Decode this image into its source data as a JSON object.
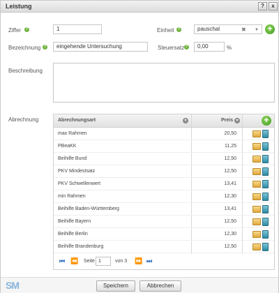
{
  "window": {
    "title": "Leistung",
    "help_label": "?",
    "close_label": "x"
  },
  "form": {
    "ziffer_label": "Ziffer",
    "ziffer_value": "1",
    "einheit_label": "Einheit",
    "einheit_value": "pauschal",
    "bezeichnung_label": "Bezeichnung",
    "bezeichnung_value": "eingehende Untersuchung",
    "steuersatz_label": "Steuersatz",
    "steuersatz_value": "0,00",
    "steuersatz_unit": "%",
    "beschreibung_label": "Beschreibung",
    "abrechnung_label": "Abrechnung"
  },
  "grid": {
    "col_abrechnungsart": "Abrechnungsart",
    "col_preis": "Preis",
    "rows": [
      {
        "name": "max Rahmen",
        "price": "20,50"
      },
      {
        "name": "PBeaKK",
        "price": "11,25"
      },
      {
        "name": "Beihilfe Bund",
        "price": "12,50"
      },
      {
        "name": "PKV Mindestsatz",
        "price": "12,50"
      },
      {
        "name": "PKV Schwellenwert",
        "price": "13,41"
      },
      {
        "name": "min Rahmen",
        "price": "12,30"
      },
      {
        "name": "Beihilfe Baden-Württemberg",
        "price": "13,41"
      },
      {
        "name": "Beihilfe Bayern",
        "price": "12,50"
      },
      {
        "name": "Beihilfe Berlin",
        "price": "12,30"
      },
      {
        "name": "Beihilfe Brandenburg",
        "price": "12,50"
      }
    ],
    "pager": {
      "seite_label": "Seite",
      "page_value": "1",
      "von_label": "von 3"
    }
  },
  "footer": {
    "logo": "SM",
    "speichern_label": "Speichern",
    "abbrechen_label": "Abbrechen"
  },
  "colors": {
    "accent_green": "#6fb43f",
    "pager_blue": "#2f6fc0",
    "logo_blue": "#86b4dc"
  }
}
